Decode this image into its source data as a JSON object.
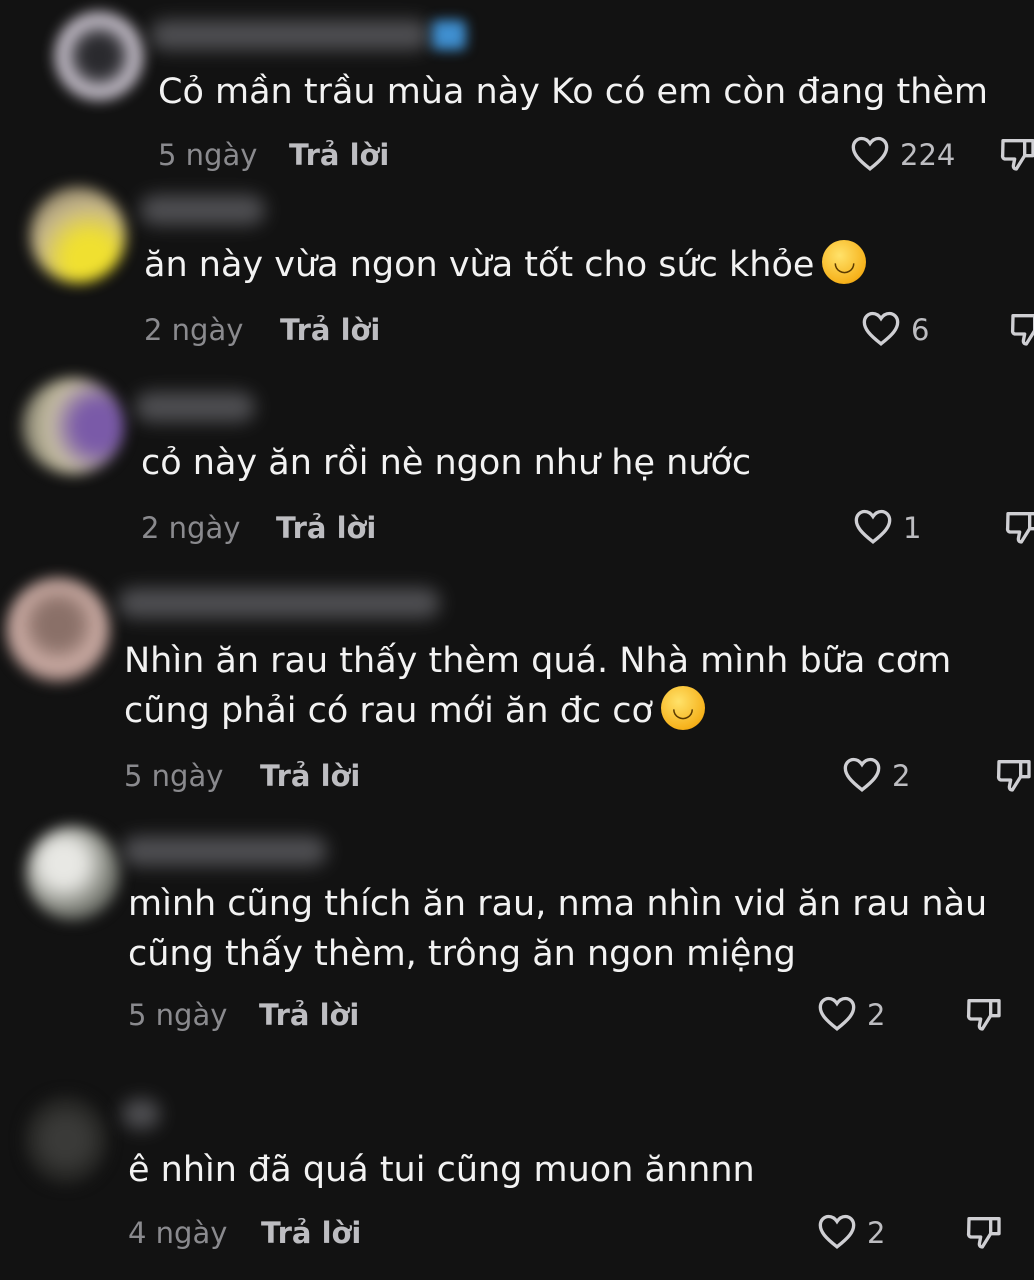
{
  "comments": [
    {
      "text": [
        "Cỏ mần trầu mùa này Ko có em còn đang thèm"
      ],
      "time": "5 ngày",
      "reply": "Trả lời",
      "likes": "224",
      "emoji": ""
    },
    {
      "text": [
        "ăn này vừa ngon vừa tốt cho sức khỏe"
      ],
      "time": "2 ngày",
      "reply": "Trả lời",
      "likes": "6",
      "emoji": "smiling-face-with-hearts"
    },
    {
      "text": [
        "cỏ này ăn rồi nè ngon như hẹ nước"
      ],
      "time": "2 ngày",
      "reply": "Trả lời",
      "likes": "1",
      "emoji": ""
    },
    {
      "text": [
        "Nhìn ăn rau thấy thèm quá. Nhà mình bữa cơm",
        "cũng phải có rau mới ăn đc cơ"
      ],
      "time": "5 ngày",
      "reply": "Trả lời",
      "likes": "2",
      "emoji": "rolling-on-floor-laughing"
    },
    {
      "text": [
        "mình cũng thích ăn rau, nma nhìn vid ăn rau nàu",
        "cũng thấy thèm, trông ăn ngon miệng"
      ],
      "time": "5 ngày",
      "reply": "Trả lời",
      "likes": "2",
      "emoji": ""
    },
    {
      "text": [
        "ê nhìn đã quá tui cũng muon ănnnn"
      ],
      "time": "4 ngày",
      "reply": "Trả lời",
      "likes": "2",
      "emoji": ""
    }
  ],
  "icons": {
    "like": "heart-outline-icon",
    "dislike": "thumbs-down-icon"
  },
  "colors": {
    "background": "#121212",
    "text": "#f2f2f2",
    "meta": "#8a8a8e",
    "reply": "#bdbdc1"
  }
}
